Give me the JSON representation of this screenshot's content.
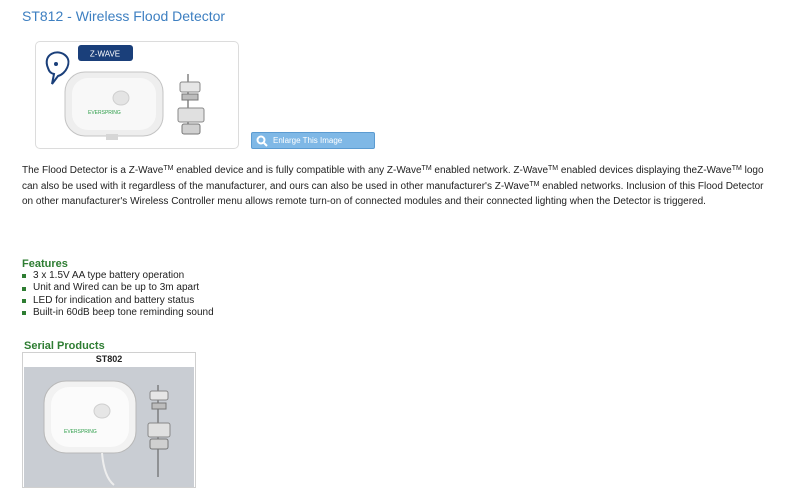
{
  "page": {
    "title": "ST812 - Wireless Flood Detector"
  },
  "product_image": {
    "badge_text": "Z-WAVE",
    "device_brand_text": "EVERSPRING",
    "enlarge_label": "Enlarge This Image"
  },
  "description": {
    "p1": "The Flood Detector is a Z-Wave",
    "tm1": "TM",
    "p2": "  enabled device and is fully compatible with any Z-Wave",
    "tm2": "TM",
    "p3": "  enabled network. Z-Wave",
    "tm3": "TM",
    "p4": "  enabled devices displaying theZ-Wave",
    "tm4": "TM",
    "p5": "  logo can also be used with it regardless of the manufacturer, and ours can also be used in other manufacturer's Z-Wave",
    "tm5": "TM",
    "p6": "  enabled networks.  Inclusion of this Flood Detector on other manufacturer's Wireless Controller menu allows remote turn-on of connected modules and their connected lighting when the Detector is triggered."
  },
  "features": {
    "heading": "Features",
    "items": [
      "3 x 1.5V AA type battery operation",
      "Unit and Wired can be up to 3m apart",
      "LED for indication and battery status",
      "Built-in 60dB beep tone reminding sound"
    ]
  },
  "serial_products": {
    "heading": "Serial Products",
    "items": [
      {
        "model": "ST802"
      }
    ]
  },
  "colors": {
    "title": "#3d7fc1",
    "heading_green": "#2e7d32",
    "enlarge_button": "#7fb8e6"
  }
}
